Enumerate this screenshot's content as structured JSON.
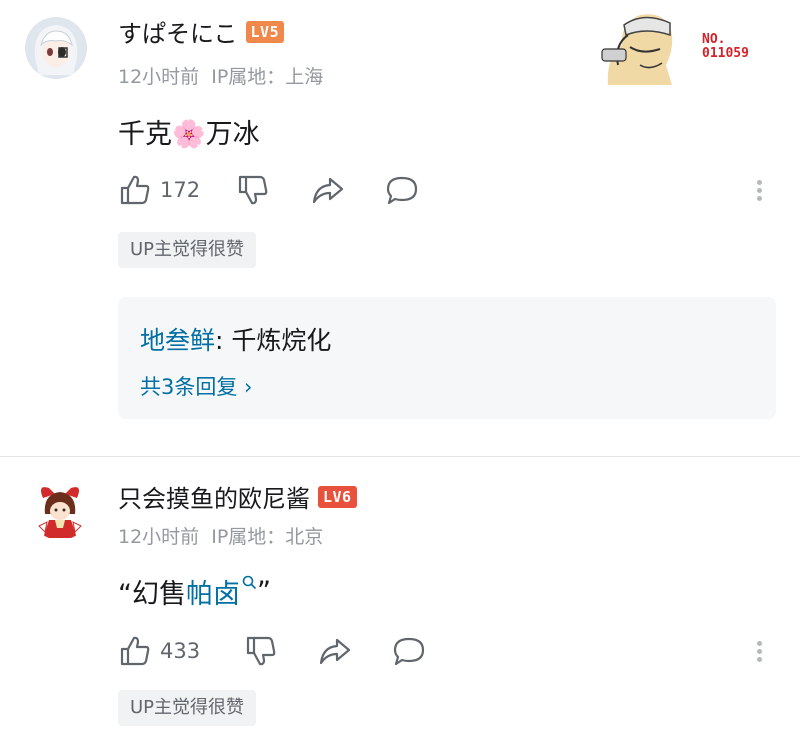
{
  "colors": {
    "lv5": "#f0884b",
    "lv6": "#e8523c",
    "link": "#006fa3",
    "meta": "#9499a0"
  },
  "comments": [
    {
      "username": "すぱそにこ",
      "level": "LV5",
      "time": "12小时前",
      "ip": "IP属地：上海",
      "content_part1": "千克",
      "content_emoji": "🌸",
      "content_part2": "万冰",
      "likes": "172",
      "up_tag": "UP主觉得很赞",
      "badge_no": "NO.",
      "badge_number": "011059",
      "reply_preview": {
        "user": "地叁鲜",
        "text": ": 千炼烷化"
      },
      "reply_count": "共3条回复 ›"
    },
    {
      "username": "只会摸鱼的欧尼酱",
      "level": "LV6",
      "time": "12小时前",
      "ip": "IP属地：北京",
      "content_prefix": "“幻售",
      "content_link": "帕卤",
      "content_suffix": "”",
      "likes": "433",
      "up_tag": "UP主觉得很赞"
    }
  ],
  "icons": [
    "like-icon",
    "dislike-icon",
    "share-icon",
    "reply-icon",
    "more-icon",
    "search-icon"
  ]
}
